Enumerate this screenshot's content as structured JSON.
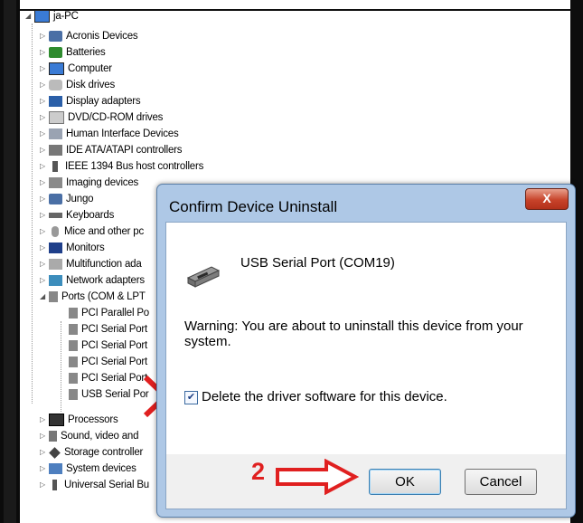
{
  "tree": {
    "root": "ja-PC",
    "items": [
      {
        "label": "Acronis Devices",
        "icon": "device-icon"
      },
      {
        "label": "Batteries",
        "icon": "battery-icon"
      },
      {
        "label": "Computer",
        "icon": "computer-icon"
      },
      {
        "label": "Disk drives",
        "icon": "disk-icon"
      },
      {
        "label": "Display adapters",
        "icon": "display-icon"
      },
      {
        "label": "DVD/CD-ROM drives",
        "icon": "dvd-icon"
      },
      {
        "label": "Human Interface Devices",
        "icon": "hid-icon"
      },
      {
        "label": "IDE ATA/ATAPI controllers",
        "icon": "ide-icon"
      },
      {
        "label": "IEEE 1394 Bus host controllers",
        "icon": "firewire-icon"
      },
      {
        "label": "Imaging devices",
        "icon": "imaging-icon"
      },
      {
        "label": "Jungo",
        "icon": "device-icon"
      },
      {
        "label": "Keyboards",
        "icon": "keyboard-icon"
      },
      {
        "label": "Mice and other pc",
        "icon": "mouse-icon"
      },
      {
        "label": "Monitors",
        "icon": "monitor-icon"
      },
      {
        "label": "Multifunction ada",
        "icon": "multifunction-icon"
      },
      {
        "label": "Network adapters",
        "icon": "network-icon"
      },
      {
        "label": "Ports (COM & LPT",
        "icon": "port-icon"
      },
      {
        "label": "PCI Parallel Po",
        "icon": "port-icon"
      },
      {
        "label": "PCI Serial Port",
        "icon": "port-icon"
      },
      {
        "label": "PCI Serial Port",
        "icon": "port-icon"
      },
      {
        "label": "PCI Serial Port",
        "icon": "port-icon"
      },
      {
        "label": "PCI Serial Port",
        "icon": "port-icon"
      },
      {
        "label": "USB Serial Por",
        "icon": "port-icon"
      },
      {
        "label": "Processors",
        "icon": "processor-icon"
      },
      {
        "label": "Sound, video and",
        "icon": "sound-icon"
      },
      {
        "label": "Storage controller",
        "icon": "storage-icon"
      },
      {
        "label": "System devices",
        "icon": "system-icon"
      },
      {
        "label": "Universal Serial Bu",
        "icon": "usb-icon"
      }
    ]
  },
  "dialog": {
    "title": "Confirm Device Uninstall",
    "close_label": "X",
    "device_name": "USB Serial Port (COM19)",
    "warning": "Warning: You are about to uninstall this device from your system.",
    "checkbox_label": "Delete the driver software for this device.",
    "checkbox_checked": true,
    "ok_label": "OK",
    "cancel_label": "Cancel"
  },
  "annotation": {
    "step_number": "2",
    "color": "#e02020"
  }
}
